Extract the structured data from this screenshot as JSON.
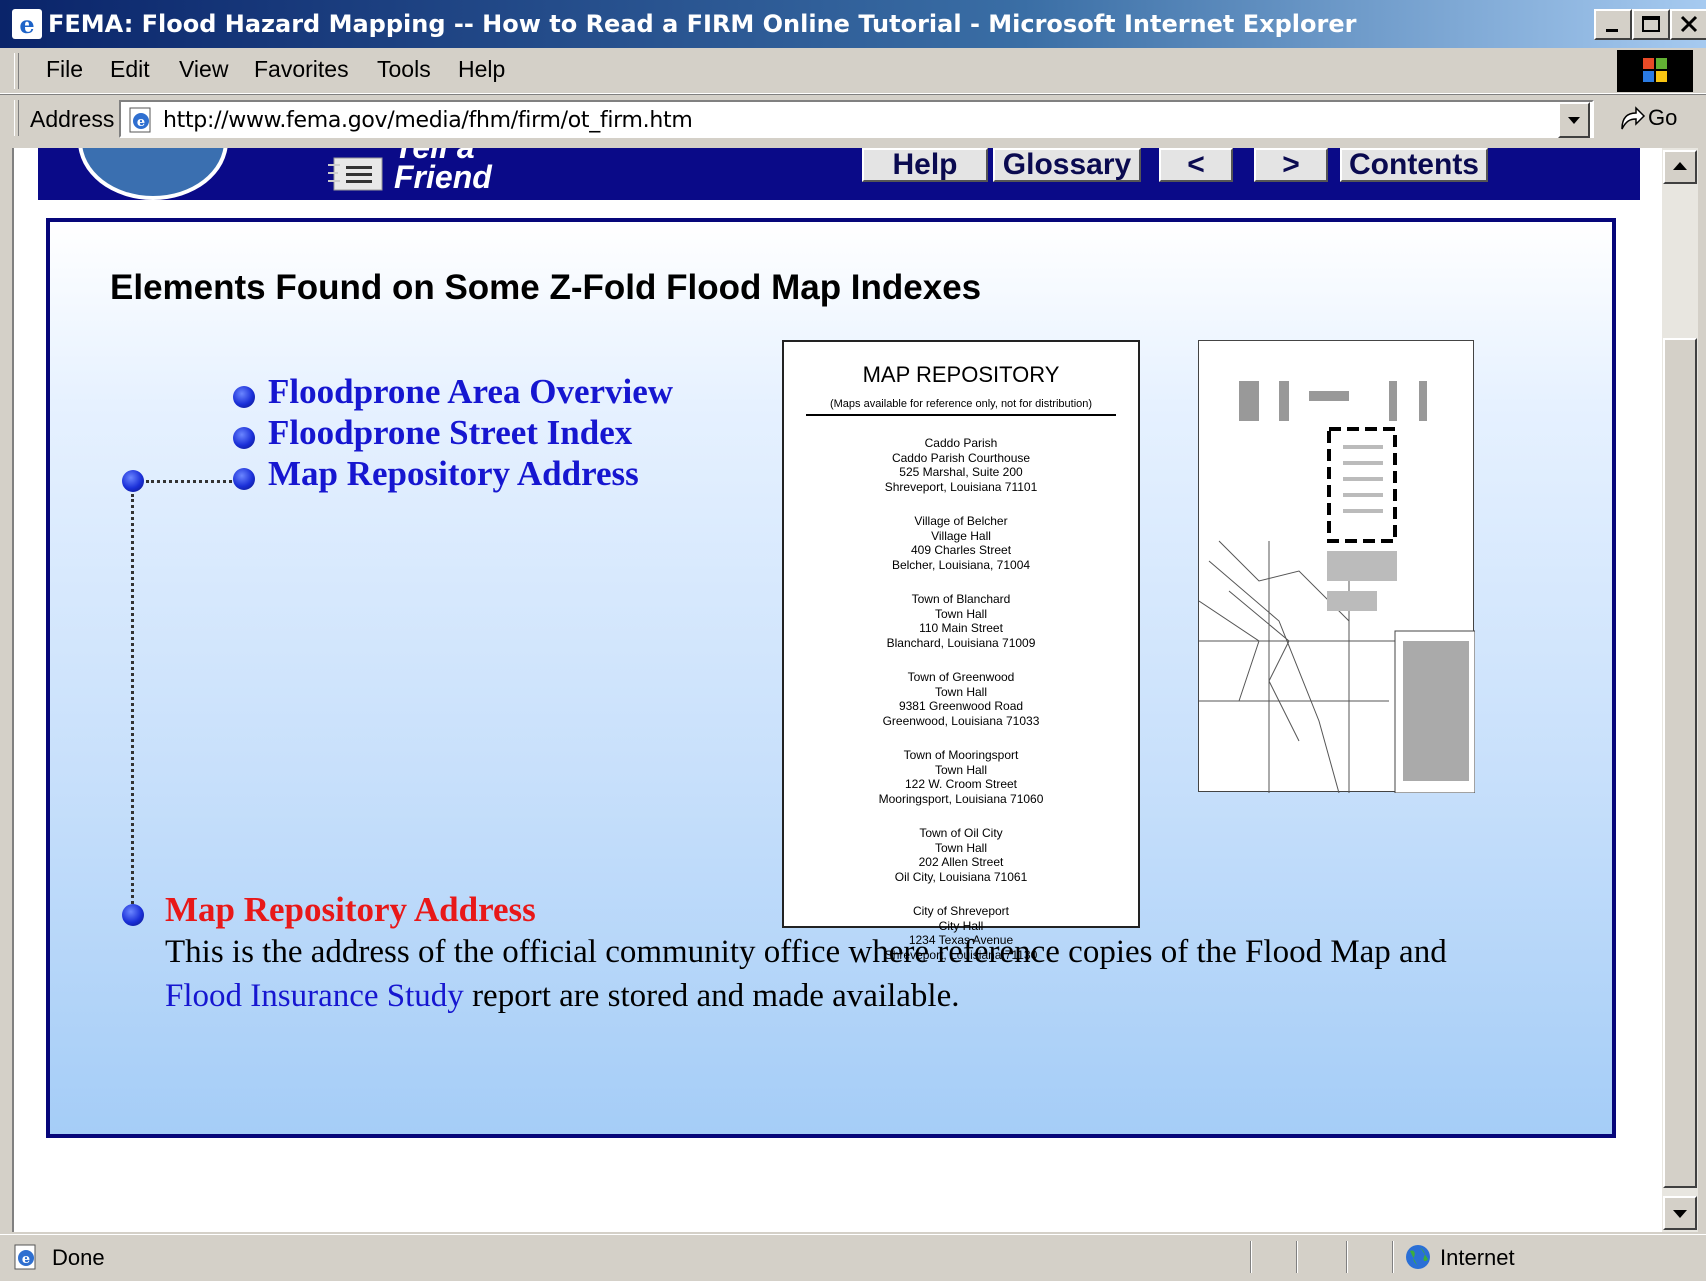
{
  "window": {
    "title": "FEMA: Flood Hazard Mapping -- How to Read a FIRM Online Tutorial - Microsoft Internet Explorer"
  },
  "menu": {
    "items": [
      "File",
      "Edit",
      "View",
      "Favorites",
      "Tools",
      "Help"
    ]
  },
  "address": {
    "label": "Address",
    "url": "http://www.fema.gov/media/fhm/firm/ot_firm.htm",
    "go_label": "Go"
  },
  "banner": {
    "tell_friend": "Tell a Friend",
    "nav": [
      "Help",
      "Glossary",
      "<",
      ">",
      "Contents"
    ]
  },
  "content": {
    "heading": "Elements Found on Some Z-Fold Flood Map Indexes",
    "links": [
      "Floodprone Area Overview",
      "Floodprone Street Index",
      "Map Repository Address"
    ],
    "desc_title": "Map Repository Address",
    "desc_text_1": "This is the address of the official community office where reference copies of the Flood Map and ",
    "desc_link": "Flood Insurance Study",
    "desc_text_2": " report are stored and made available."
  },
  "card": {
    "title": "MAP REPOSITORY",
    "subtitle": "(Maps available for reference only, not for distribution)",
    "addresses": [
      [
        "Caddo Parish",
        "Caddo Parish Courthouse",
        "525 Marshal, Suite 200",
        "Shreveport, Louisiana 71101"
      ],
      [
        "Village of Belcher",
        "Village Hall",
        "409 Charles Street",
        "Belcher, Louisiana, 71004"
      ],
      [
        "Town of Blanchard",
        "Town Hall",
        "110 Main Street",
        "Blanchard, Louisiana 71009"
      ],
      [
        "Town of Greenwood",
        "Town Hall",
        "9381 Greenwood Road",
        "Greenwood, Louisiana 71033"
      ],
      [
        "Town of Mooringsport",
        "Town Hall",
        "122 W. Croom Street",
        "Mooringsport, Louisiana 71060"
      ],
      [
        "Town of Oil City",
        "Town Hall",
        "202 Allen Street",
        "Oil City, Louisiana 71061"
      ],
      [
        "City of Shreveport",
        "City Hall",
        "1234 Texas Avenue",
        "Shreveport, Louisiana 71130"
      ]
    ]
  },
  "status": {
    "text": "Done",
    "zone": "Internet"
  },
  "colors": {
    "titlebar": "#0a246a",
    "banner": "#0a0a88",
    "link": "#1616d0",
    "desc_title": "#e81818"
  }
}
